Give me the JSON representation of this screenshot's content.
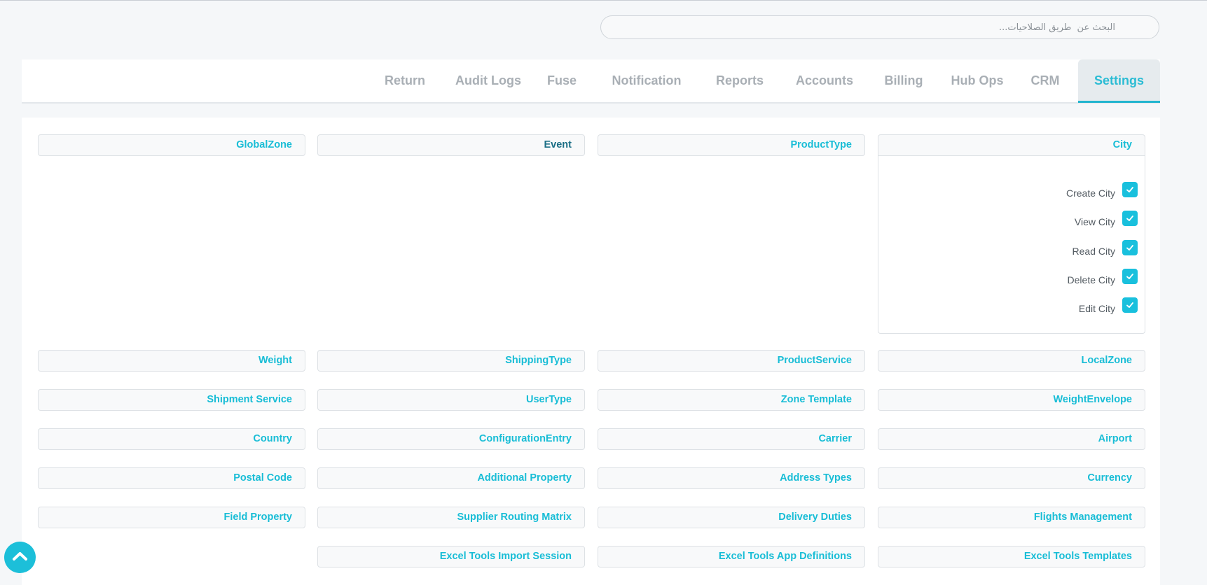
{
  "search": {
    "placeholder": "البحث عن  طريق الصلاحيات..."
  },
  "tabs": [
    {
      "label": "Settings"
    },
    {
      "label": "CRM"
    },
    {
      "label": "Hub Ops"
    },
    {
      "label": "Billing"
    },
    {
      "label": "Accounts"
    },
    {
      "label": "Reports"
    },
    {
      "label": "Notification"
    },
    {
      "label": "Fuse"
    },
    {
      "label": "Audit Logs"
    },
    {
      "label": "Return"
    }
  ],
  "active_tab": "Settings",
  "city": {
    "title": "City",
    "permissions": [
      {
        "label": "Create City",
        "checked": true
      },
      {
        "label": "View City",
        "checked": true
      },
      {
        "label": "Read City",
        "checked": true
      },
      {
        "label": "Delete City",
        "checked": true
      },
      {
        "label": "Edit City",
        "checked": true
      }
    ]
  },
  "groups": {
    "row1": [
      "GlobalZone",
      "Event",
      "ProductType"
    ],
    "row2": [
      "Weight",
      "ShippingType",
      "ProductService",
      "LocalZone"
    ],
    "row3": [
      "Shipment Service",
      "UserType",
      "Zone Template",
      "WeightEnvelope"
    ],
    "row4": [
      "Country",
      "ConfigurationEntry",
      "Carrier",
      "Airport"
    ],
    "row5": [
      "Postal Code",
      "Additional Property",
      "Address Types",
      "Currency"
    ],
    "row6": [
      "Field Property",
      "Supplier Routing Matrix",
      "Delivery Duties",
      "Flights Management"
    ],
    "row7": [
      "Excel Tools Import Session",
      "Excel Tools App Definitions",
      "Excel Tools Templates"
    ]
  },
  "colors": {
    "accent": "#19c0dd",
    "tab_inactive": "#a9afb5"
  }
}
